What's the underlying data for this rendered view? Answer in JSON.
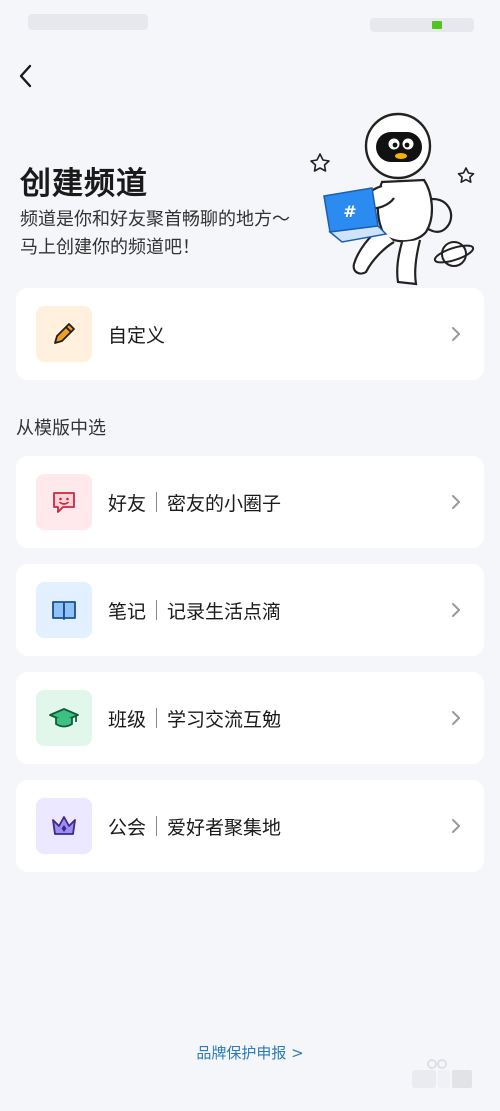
{
  "hero": {
    "title": "创建频道",
    "subtitle_line1": "频道是你和好友聚首畅聊的地方～",
    "subtitle_line2": "马上创建你的频道吧！"
  },
  "custom_option": {
    "label": "自定义",
    "icon": "pencil-icon",
    "icon_bg": "#fff1dd",
    "icon_color": "#f0a020"
  },
  "templates_label": "从模版中选",
  "templates": [
    {
      "name": "好友",
      "desc": "密友的小圈子",
      "icon": "chat-smile-icon",
      "icon_bg": "#ffe9ec",
      "icon_color": "#e5485d"
    },
    {
      "name": "笔记",
      "desc": "记录生活点滴",
      "icon": "book-icon",
      "icon_bg": "#e2f0ff",
      "icon_color": "#3b82d6"
    },
    {
      "name": "班级",
      "desc": "学习交流互勉",
      "icon": "graduation-cap-icon",
      "icon_bg": "#e2f7ec",
      "icon_color": "#26a269"
    },
    {
      "name": "公会",
      "desc": "爱好者聚集地",
      "icon": "crown-icon",
      "icon_bg": "#ece8ff",
      "icon_color": "#6b55d8"
    }
  ],
  "footer": {
    "brand_link": "品牌保护申报 >"
  }
}
